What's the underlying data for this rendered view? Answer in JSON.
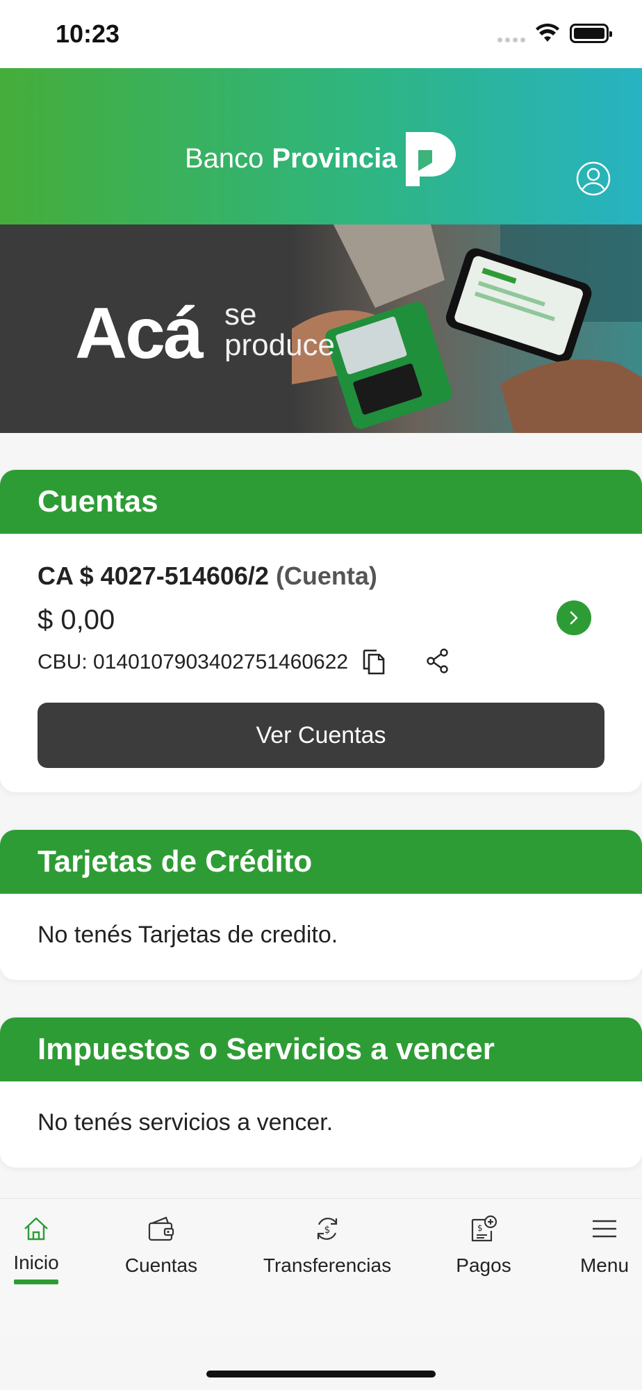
{
  "status_bar": {
    "time": "10:23"
  },
  "header": {
    "brand_regular": "Banco",
    "brand_bold": "Provincia",
    "profile_icon": "user-circle-icon"
  },
  "banner": {
    "headline": "Acá",
    "line1": "se",
    "line2": "produce"
  },
  "accounts": {
    "title": "Cuentas",
    "account_number": "CA $ 4027-514606/2",
    "account_type": "(Cuenta)",
    "balance": "$ 0,00",
    "cbu": "CBU: 0140107903402751460622",
    "view_button": "Ver Cuentas"
  },
  "credit_cards": {
    "title": "Tarjetas de Crédito",
    "empty_message": "No tenés Tarjetas de credito."
  },
  "services": {
    "title": "Impuestos o Servicios a vencer",
    "empty_message": "No tenés servicios a vencer."
  },
  "bottom_nav": {
    "items": [
      {
        "label": "Inicio",
        "icon": "home-icon",
        "active": true
      },
      {
        "label": "Cuentas",
        "icon": "wallet-icon",
        "active": false
      },
      {
        "label": "Transferencias",
        "icon": "transfer-icon",
        "active": false
      },
      {
        "label": "Pagos",
        "icon": "payments-icon",
        "active": false
      },
      {
        "label": "Menu",
        "icon": "menu-icon",
        "active": false
      }
    ]
  },
  "colors": {
    "primary_green": "#2e9c35",
    "dark_button": "#3c3c3c",
    "header_gradient_start": "#45ad3a",
    "header_gradient_end": "#27b3c2"
  }
}
